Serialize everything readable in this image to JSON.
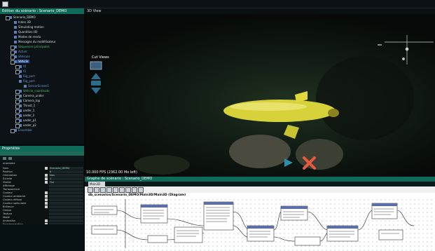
{
  "editor": {
    "title": "Edition du scénario : Scenario_DEMO",
    "tree": [
      {
        "label": "Scenario_DEMO",
        "level": 1,
        "box": true,
        "color": "plain"
      },
      {
        "label": "Index 3D",
        "level": 2,
        "box": false,
        "color": "plain"
      },
      {
        "label": "Simulating motion",
        "level": 2,
        "box": false,
        "color": "plain"
      },
      {
        "label": "Quantities (8)",
        "level": 2,
        "box": false,
        "color": "plain"
      },
      {
        "label": "Modes de rendu",
        "level": 2,
        "box": false,
        "color": "plain"
      },
      {
        "label": "Messages du modélisateur",
        "level": 2,
        "box": false,
        "color": "plain"
      },
      {
        "label": "Séquences principales",
        "level": 2,
        "box": true,
        "color": "green"
      },
      {
        "label": "Actuel",
        "level": 2,
        "box": true,
        "color": "blue"
      },
      {
        "label": "Véhicule",
        "level": 2,
        "box": true,
        "color": "blue"
      },
      {
        "label": "Vehicle",
        "level": 2,
        "box": true,
        "color": "blue"
      },
      {
        "label": "t0",
        "level": 3,
        "box": true,
        "color": "blue"
      },
      {
        "label": "t1",
        "level": 3,
        "box": true,
        "color": "blue"
      },
      {
        "label": "Rig_part",
        "level": 3,
        "box": false,
        "color": "blue"
      },
      {
        "label": "Rig_part",
        "level": 3,
        "box": false,
        "color": "blue"
      },
      {
        "label": "SensorScreen1",
        "level": 4,
        "box": false,
        "color": "blue"
      },
      {
        "label": "Vehicle_coordinate",
        "level": 3,
        "box": true,
        "color": "green"
      },
      {
        "label": "Camera_under",
        "level": 3,
        "box": true,
        "color": "plain"
      },
      {
        "label": "Camera_top",
        "level": 3,
        "box": true,
        "color": "plain"
      },
      {
        "label": "Thrust_1",
        "level": 3,
        "box": true,
        "color": "plain"
      },
      {
        "label": "under_1",
        "level": 3,
        "box": true,
        "color": "plain"
      },
      {
        "label": "under_2",
        "level": 3,
        "box": true,
        "color": "plain"
      },
      {
        "label": "under_p1",
        "level": 3,
        "box": true,
        "color": "plain"
      },
      {
        "label": "under_p2",
        "level": 3,
        "box": true,
        "color": "plain"
      },
      {
        "label": "Ensemble",
        "level": 2,
        "box": true,
        "color": "blue"
      }
    ]
  },
  "properties": {
    "title": "Propriétés",
    "header": "ensemble",
    "rows": [
      {
        "name": "Nom",
        "value": "Scenario_DEMO",
        "check": true
      },
      {
        "name": "Position",
        "value": "0",
        "check": false
      },
      {
        "name": "Orientation",
        "value": "Nav",
        "check": true
      },
      {
        "name": "Echelle",
        "value": "1",
        "check": true
      },
      {
        "name": "Visible",
        "value": "Oui",
        "check": true
      },
      {
        "name": "Affichage",
        "value": "",
        "check": false
      },
      {
        "name": "Transparence",
        "value": "",
        "check": false
      },
      {
        "name": "Couleur",
        "value": "",
        "check": true
      },
      {
        "name": "Couleur ambiante",
        "value": "",
        "check": true
      },
      {
        "name": "Couleur diffuse",
        "value": "",
        "check": true
      },
      {
        "name": "Couleur spéculaire",
        "value": "",
        "check": true
      },
      {
        "name": "Brillance",
        "value": "",
        "check": true
      },
      {
        "name": "Ombre",
        "value": "",
        "check": false
      },
      {
        "name": "Texture",
        "value": "",
        "check": false
      },
      {
        "name": "Mode",
        "value": "",
        "check": false
      },
      {
        "name": "Animation",
        "value": "",
        "check": true
      },
      {
        "name": "Synchronisation",
        "value": "",
        "check": true
      }
    ]
  },
  "view3d": {
    "title": "3D View",
    "camera_label": "Cut Views",
    "fps": "10.000 FPS (2362.00 Mo left)"
  },
  "graph": {
    "title": "Graphe de scénario : Scenario_DEMO",
    "tab": "Main3D",
    "path": "db_scenarios/Scenario_DEMO/Main3D/Main3D (Diagram)"
  },
  "colors": {
    "panel_header": "#0f6a5a",
    "vehicle": "#d8d23a",
    "node_header": "#5c6ea8"
  }
}
